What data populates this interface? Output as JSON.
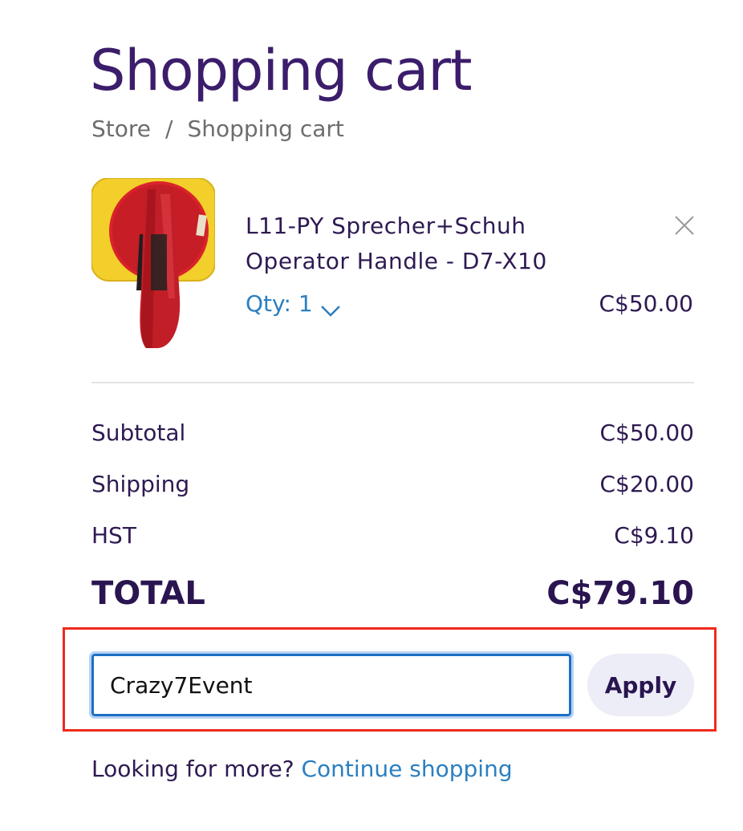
{
  "page": {
    "title": "Shopping cart"
  },
  "breadcrumb": {
    "items": [
      "Store",
      "Shopping cart"
    ],
    "separator": "/"
  },
  "cart": {
    "items": [
      {
        "name": "L11-PY Sprecher+Schuh Operator Handle - D7-X10",
        "qty_label": "Qty: 1",
        "price": "C$50.00",
        "image": "product-photo-operator-handle",
        "remove_icon": "close-icon"
      }
    ]
  },
  "summary": {
    "subtotal_label": "Subtotal",
    "subtotal_value": "C$50.00",
    "shipping_label": "Shipping",
    "shipping_value": "C$20.00",
    "tax_label": "HST",
    "tax_value": "C$9.10",
    "total_label": "TOTAL",
    "total_value": "C$79.10"
  },
  "coupon": {
    "value": "Crazy7Event",
    "apply_label": "Apply"
  },
  "footer": {
    "prompt": "Looking for more?",
    "link_label": "Continue shopping"
  },
  "colors": {
    "brand": "#3b1d6b",
    "link": "#2b7fc0",
    "highlight": "#ee2a1b",
    "focus": "#1c6fc4"
  }
}
